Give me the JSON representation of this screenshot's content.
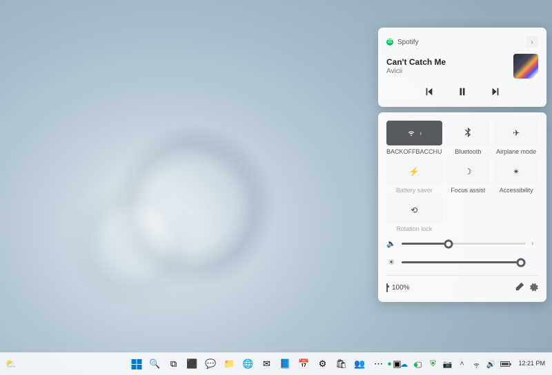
{
  "media": {
    "app": "Spotify",
    "title": "Can't Catch Me",
    "artist": "Avicii"
  },
  "quick_settings": {
    "tiles": [
      {
        "label": "BACKOFFBACCHU",
        "icon": "wifi",
        "active": true,
        "expandable": true
      },
      {
        "label": "Bluetooth",
        "icon": "bluetooth",
        "active": false
      },
      {
        "label": "Airplane mode",
        "icon": "airplane",
        "active": false
      },
      {
        "label": "Battery saver",
        "icon": "battery-saver",
        "active": false,
        "dim": true
      },
      {
        "label": "Focus assist",
        "icon": "moon",
        "active": false
      },
      {
        "label": "Accessibility",
        "icon": "accessibility",
        "active": false
      },
      {
        "label": "Rotation lock",
        "icon": "rotation",
        "active": false,
        "dim": true
      }
    ],
    "volume_pct": 38,
    "brightness_pct": 96,
    "battery_text": "100%"
  },
  "taskbar": {
    "clock_time": "12:21 PM",
    "tray": [
      "spotify",
      "onedrive",
      "onenote",
      "defender",
      "meet-now",
      "wifi",
      "volume",
      "battery"
    ],
    "pinned_center": [
      "start",
      "search",
      "task-view",
      "widgets",
      "chat",
      "explorer",
      "edge",
      "mail",
      "word",
      "calendar",
      "settings",
      "store",
      "teams",
      "more",
      "terminal",
      "spotify"
    ]
  }
}
